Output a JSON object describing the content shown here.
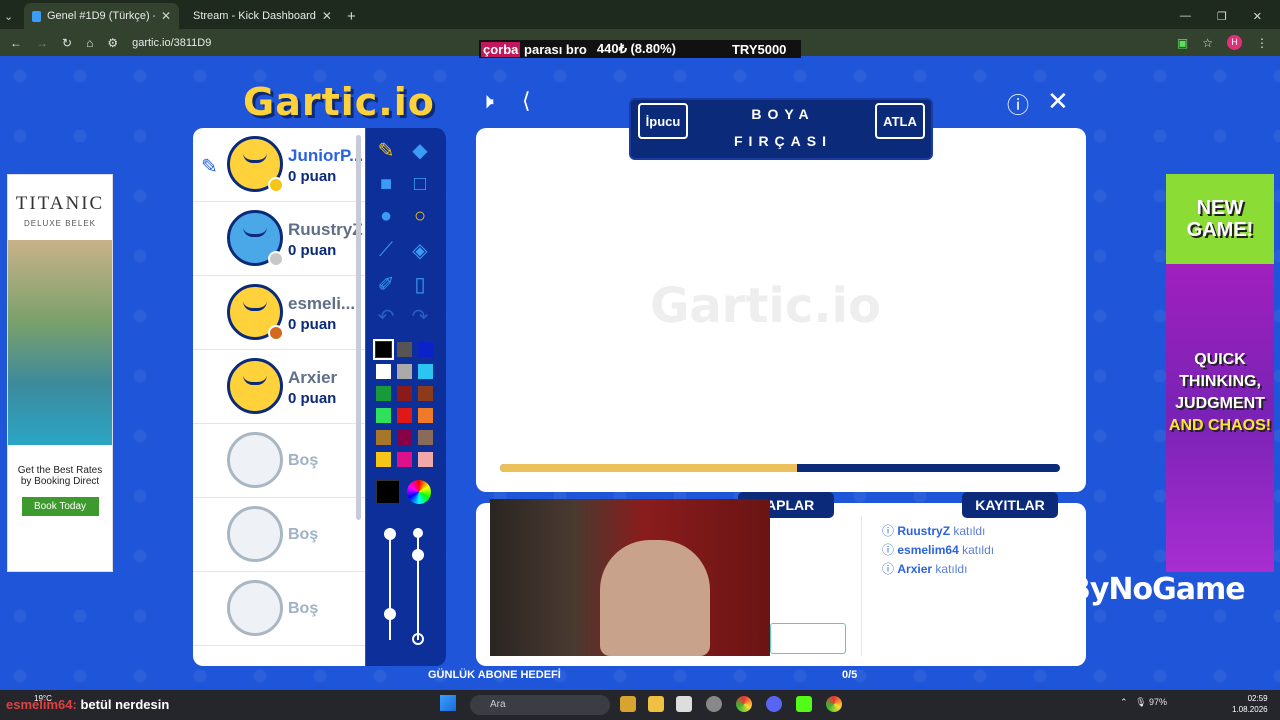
{
  "browser": {
    "tabs": [
      {
        "title": "Genel #1D9 (Türkçe) - Gartic.io",
        "active": true
      },
      {
        "title": "Stream - Kick Dashboard",
        "active": false
      }
    ],
    "url": "gartic.io/3811D9",
    "profile_initial": "H"
  },
  "ticker": {
    "highlight": "çorba",
    "text": " parası bro",
    "amount": "440₺ (8.80%)",
    "goal": "TRY5000"
  },
  "game": {
    "logo": "Gartic.io",
    "watermark": "Gartic.io",
    "hint_button": "İpucu",
    "word_line1": "BOYA",
    "word_line2": "FIRÇASI",
    "skip_button": "ATLA",
    "timer_progress": 0.53,
    "players": [
      {
        "name": "JuniorP...",
        "score": "0 puan",
        "drawing": true,
        "dot_color": "#f5c518"
      },
      {
        "name": "RuustryZ",
        "score": "0 puan",
        "drawing": false,
        "dot_color": "#c8c8c8"
      },
      {
        "name": "esmeli...",
        "score": "0 puan",
        "drawing": false,
        "dot_color": "#d2691e"
      },
      {
        "name": "Arxier",
        "score": "0 puan",
        "drawing": false,
        "dot_color": ""
      }
    ],
    "empty_slots": [
      "Boş",
      "Boş",
      "Boş"
    ],
    "palette": [
      "#000000",
      "#555555",
      "#0a22c8",
      "#ffffff",
      "#aaaaaa",
      "#2cc5f2",
      "#179a3a",
      "#8b1a1a",
      "#8b3a1a",
      "#2fe05a",
      "#e01818",
      "#f07a2a",
      "#a87628",
      "#880048",
      "#8a6a5a",
      "#f5c518",
      "#e0108a",
      "#f0a8a8"
    ],
    "current_color": "#000000",
    "answers_tab": "VAPLAR",
    "logs_tab": "KAYITLAR",
    "logs": [
      {
        "user": "RuustryZ",
        "action": "katıldı"
      },
      {
        "user": "esmelim64",
        "action": "katıldı"
      },
      {
        "user": "Arxier",
        "action": "katıldı"
      }
    ],
    "daily_goal_label": "GÜNLÜK ABONE HEDEFİ",
    "daily_goal_value": "0/5"
  },
  "ads": {
    "left": {
      "brand": "TITANIC",
      "sub": "DELUXE BELEK",
      "text": "Get the Best Rates by Booking Direct",
      "button": "Book Today"
    },
    "right": {
      "line1": "NEW GAME!",
      "line2": "QUICK THINKING, JUDGMENT",
      "line3": "AND CHAOS!"
    }
  },
  "sponsor": "ByNoGame",
  "chat_overlay": {
    "user": "esmelim64:",
    "message": " betül nerdesin"
  },
  "taskbar": {
    "weather": "19°C",
    "search_placeholder": "Ara",
    "battery": "97%",
    "time": "02:59",
    "date": "1.08.2026"
  }
}
